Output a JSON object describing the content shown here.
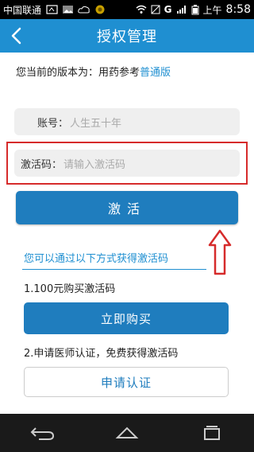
{
  "status_bar": {
    "carrier": "中国联通",
    "network": "G",
    "ampm": "上午",
    "time": "8:58"
  },
  "header": {
    "title": "授权管理"
  },
  "version": {
    "prefix": "您当前的版本为：用药参考",
    "edition": "普通版"
  },
  "account": {
    "label": "账号：",
    "value": "人生五十年"
  },
  "activation_code": {
    "label": "激活码：",
    "placeholder": "请输入激活码"
  },
  "activate_button": "激活",
  "hint": "您可以通过以下方式获得激活码",
  "option1": {
    "text": "1.100元购买激活码",
    "button": "立即购买"
  },
  "option2": {
    "text": "2.申请医师认证，免费获得激活码",
    "button": "申请认证"
  },
  "colors": {
    "header": "#1f8fd1",
    "primary_button": "#1f7dbe",
    "highlight_box": "#d62b2b",
    "arrow": "#d62b2b"
  },
  "icons": [
    "back-icon",
    "up-arrow-icon",
    "nav-back-icon",
    "nav-home-icon",
    "nav-recents-icon"
  ]
}
